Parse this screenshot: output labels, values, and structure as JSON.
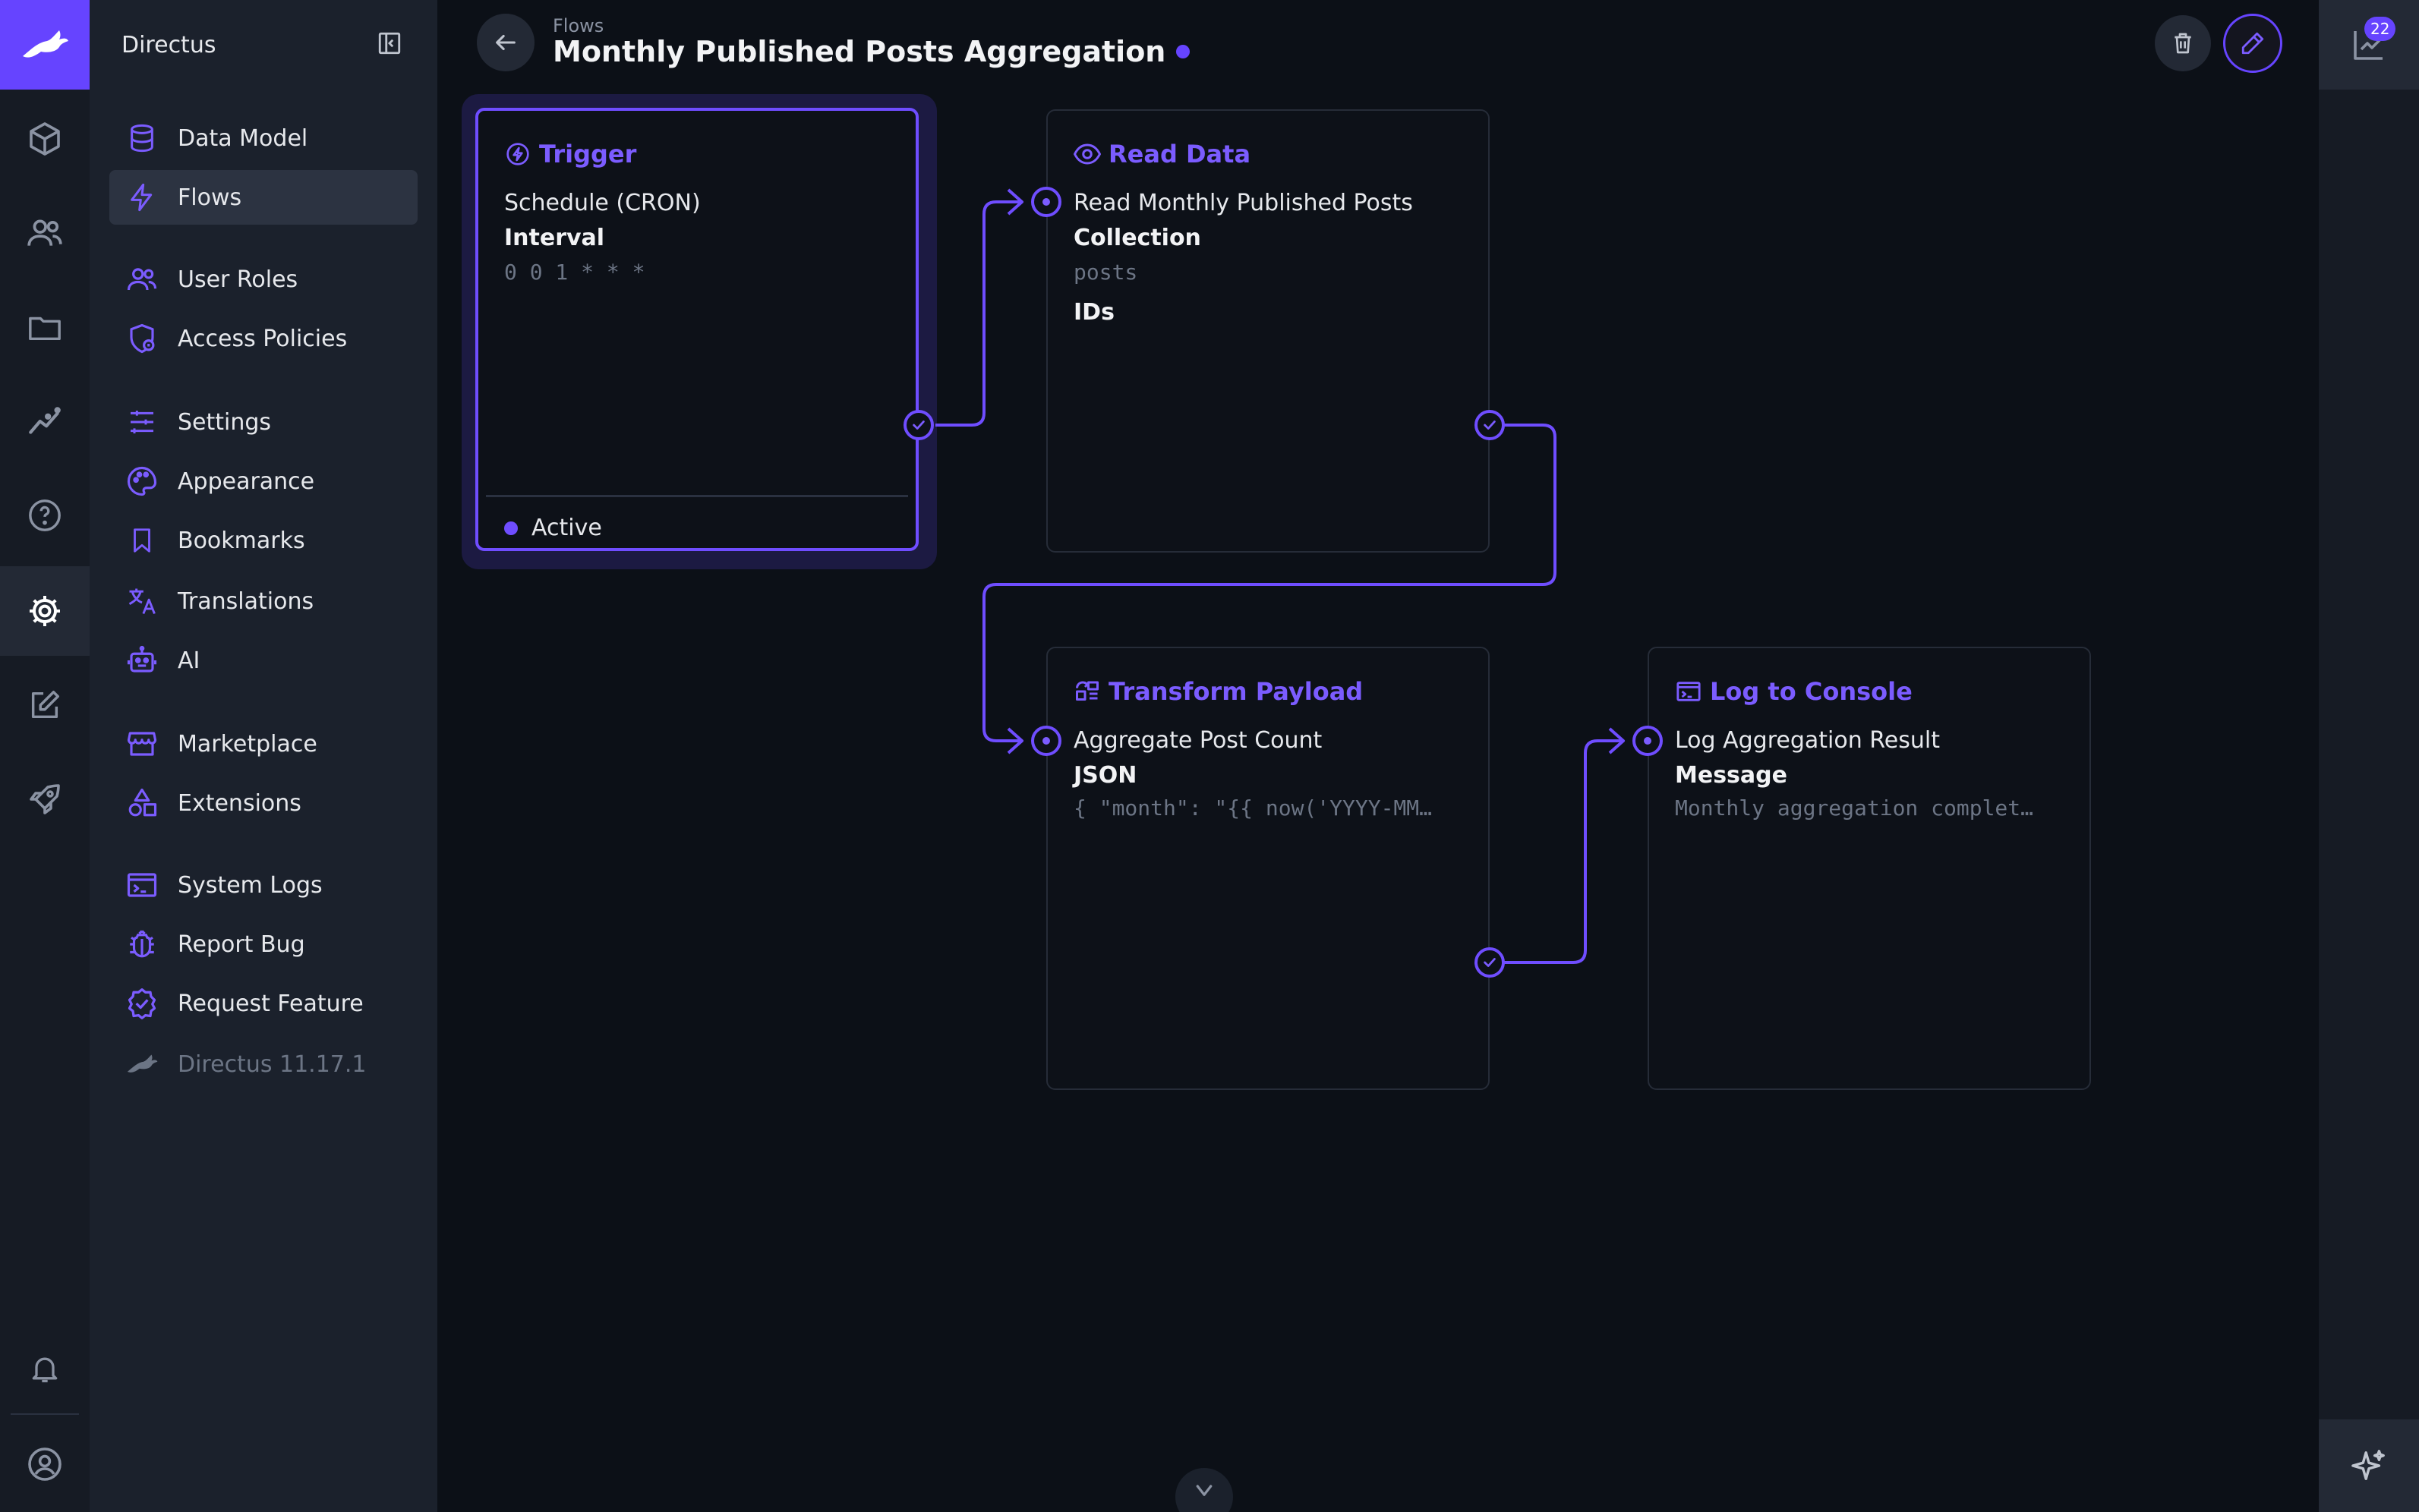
{
  "nav": {
    "title": "Directus",
    "items": [
      {
        "label": "Data Model"
      },
      {
        "label": "Flows"
      },
      {
        "label": "User Roles"
      },
      {
        "label": "Access Policies"
      },
      {
        "label": "Settings"
      },
      {
        "label": "Appearance"
      },
      {
        "label": "Bookmarks"
      },
      {
        "label": "Translations"
      },
      {
        "label": "AI"
      },
      {
        "label": "Marketplace"
      },
      {
        "label": "Extensions"
      },
      {
        "label": "System Logs"
      },
      {
        "label": "Report Bug"
      },
      {
        "label": "Request Feature"
      },
      {
        "label": "Directus 11.17.1"
      }
    ]
  },
  "header": {
    "breadcrumb": "Flows",
    "title": "Monthly Published Posts Aggregation"
  },
  "activity": {
    "badge": "22"
  },
  "flow": {
    "trigger": {
      "title": "Trigger",
      "name": "Schedule (CRON)",
      "option_label": "Interval",
      "option_value": "0 0 1 * * *",
      "status": "Active"
    },
    "read_data": {
      "title": "Read Data",
      "name": "Read Monthly Published Posts",
      "collection_label": "Collection",
      "collection_value": "posts",
      "ids_label": "IDs"
    },
    "transform": {
      "title": "Transform Payload",
      "name": "Aggregate Post Count",
      "json_label": "JSON",
      "json_value": "{ \"month\": \"{{ now('YYYY-MM…"
    },
    "log": {
      "title": "Log to Console",
      "name": "Log Aggregation Result",
      "message_label": "Message",
      "message_value": "Monthly aggregation complet…"
    }
  },
  "colors": {
    "accent": "#6644ff",
    "background": "#0c1017",
    "sidebar": "#1b212c"
  },
  "icons": {
    "modules": [
      "content-box-icon",
      "users-icon",
      "folder-icon",
      "insights-icon",
      "help-icon",
      "settings-gear-icon",
      "edit-note-icon",
      "rocket-icon",
      "bell-icon",
      "account-icon"
    ]
  }
}
